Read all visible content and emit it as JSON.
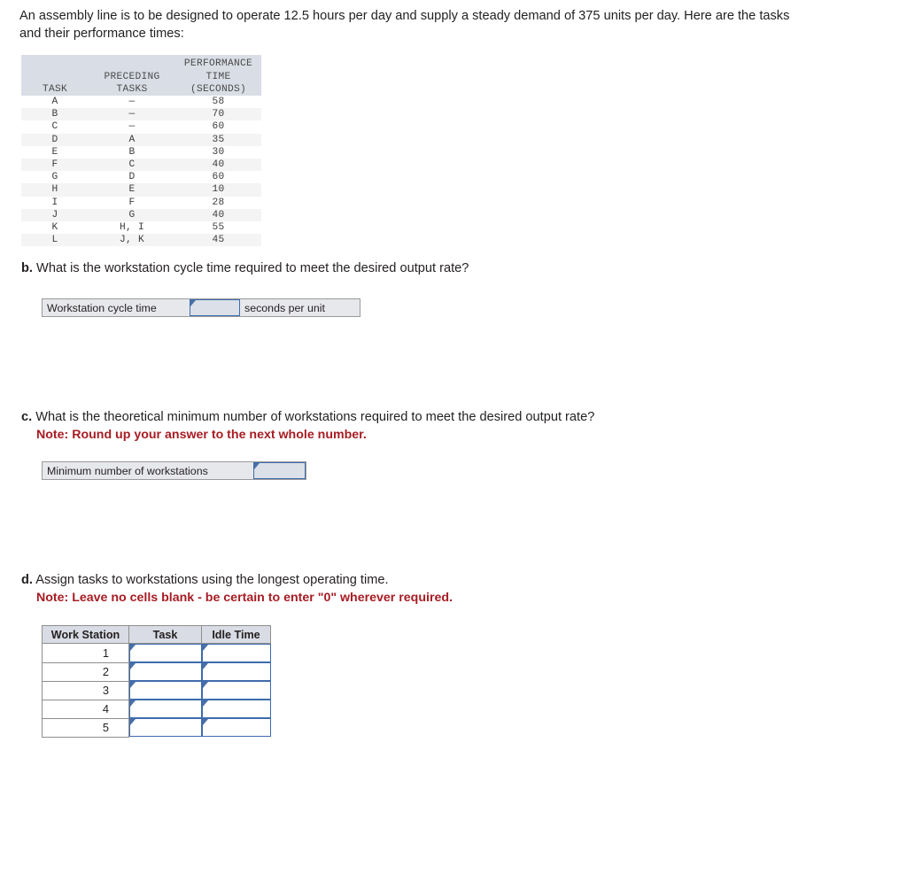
{
  "intro": {
    "text": "An assembly line is to be designed to operate 12.5 hours per day and supply a steady demand of 375 units per day. Here are the tasks and their performance times:"
  },
  "task_table": {
    "headers": {
      "task": "TASK",
      "preceding_line1": "PRECEDING",
      "preceding_line2": "TASKS",
      "performance_line1": "PERFORMANCE",
      "performance_line2": "TIME",
      "performance_line3": "(SECONDS)"
    },
    "rows": [
      {
        "task": "A",
        "preceding": "—",
        "time": "58"
      },
      {
        "task": "B",
        "preceding": "—",
        "time": "70"
      },
      {
        "task": "C",
        "preceding": "—",
        "time": "60"
      },
      {
        "task": "D",
        "preceding": "A",
        "time": "35"
      },
      {
        "task": "E",
        "preceding": "B",
        "time": "30"
      },
      {
        "task": "F",
        "preceding": "C",
        "time": "40"
      },
      {
        "task": "G",
        "preceding": "D",
        "time": "60"
      },
      {
        "task": "H",
        "preceding": "E",
        "time": "10"
      },
      {
        "task": "I",
        "preceding": "F",
        "time": "28"
      },
      {
        "task": "J",
        "preceding": "G",
        "time": "40"
      },
      {
        "task": "K",
        "preceding": "H, I",
        "time": "55"
      },
      {
        "task": "L",
        "preceding": "J, K",
        "time": "45"
      }
    ]
  },
  "question_b": {
    "letter": "b.",
    "text": "What is the workstation cycle time required to meet the desired output rate?",
    "answer_label": "Workstation cycle time",
    "answer_value": "",
    "unit_label": "seconds per unit"
  },
  "question_c": {
    "letter": "c.",
    "text": "What is the theoretical minimum number of workstations required to meet the desired output rate?",
    "note": "Note: Round up your answer to the next whole number.",
    "answer_label": "Minimum number of workstations",
    "answer_value": ""
  },
  "question_d": {
    "letter": "d.",
    "text": "Assign tasks to workstations using the longest operating time.",
    "note": "Note: Leave no cells blank - be certain to enter \"0\" wherever required.",
    "table": {
      "headers": {
        "work_station": "Work Station",
        "task": "Task",
        "idle_time": "Idle Time"
      },
      "rows": [
        {
          "station": "1",
          "task": "",
          "idle": ""
        },
        {
          "station": "2",
          "task": "",
          "idle": ""
        },
        {
          "station": "3",
          "task": "",
          "idle": ""
        },
        {
          "station": "4",
          "task": "",
          "idle": ""
        },
        {
          "station": "5",
          "task": "",
          "idle": ""
        }
      ]
    }
  },
  "colors": {
    "table_header_bg": "#d9dde5",
    "row_stripe": "#f4f4f5",
    "input_border": "#3d6cad",
    "input_fill": "#dce0e8",
    "note_red": "#a81c23",
    "strip_bg": "#e7e8ec",
    "strip_border": "#9a9a9a"
  }
}
